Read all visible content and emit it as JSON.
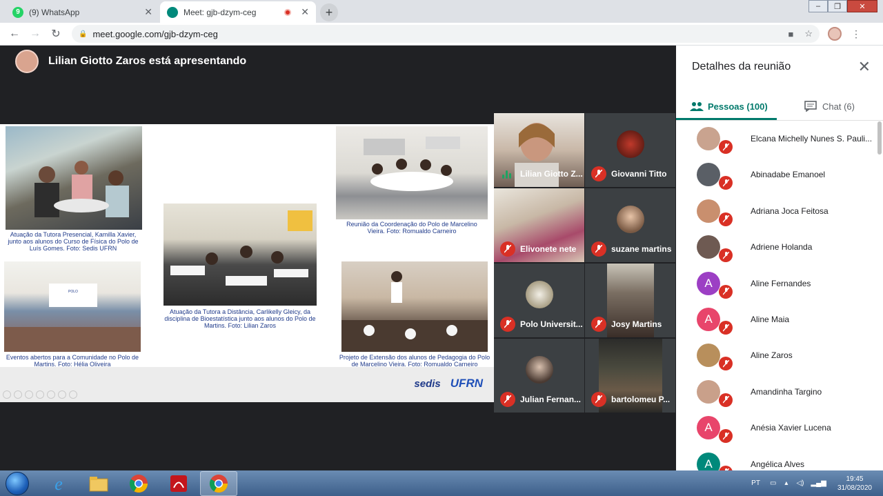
{
  "browser": {
    "tabs": [
      {
        "title": "(9) WhatsApp",
        "badge": "9",
        "active": false
      },
      {
        "title": "Meet: gjb-dzym-ceg",
        "active": true
      }
    ],
    "url": "meet.google.com/gjb-dzym-ceg"
  },
  "stage": {
    "presenter_text": "Lilian Giotto Zaros está apresentando"
  },
  "slide": {
    "captions": [
      "Atuação da Tutora Presencial, Kamilla Xavier, junto aos alunos do Curso de Física do Polo de Luís Gomes. Foto: Sedis UFRN",
      "Atuação da Tutora a Distância, Carlikelly Gleicy, da disciplina de Bioestatística junto aos alunos do Polo de Martins. Foto: Lilian Zaros",
      "Reunião da Coordenação do Polo de Marcelino Vieira. Foto: Romualdo Carneiro",
      "Eventos abertos para a Comunidade no Polo de Martins. Foto: Hélia Oliveira",
      "Projeto de Extensão dos alunos de Pedagogia do Polo de Marcelino Vieira. Foto: Romualdo Carneiro"
    ],
    "logo_sedis": "sedis",
    "logo_ufrn": "UFRN"
  },
  "tiles": [
    {
      "name": "Lilian Giotto Z...",
      "muted": false
    },
    {
      "name": "Giovanni Titto",
      "muted": true
    },
    {
      "name": "Elivonete nete",
      "muted": true
    },
    {
      "name": "suzane martins",
      "muted": true
    },
    {
      "name": "Polo Universit...",
      "muted": true
    },
    {
      "name": "Josy Martins",
      "muted": true
    },
    {
      "name": "Julian Fernan...",
      "muted": true
    },
    {
      "name": "bartolomeu P...",
      "muted": true
    }
  ],
  "panel": {
    "title": "Detalhes da reunião",
    "people_tab": "Pessoas (100)",
    "chat_tab": "Chat (6)",
    "people": [
      {
        "name": "Elcana Michelly Nunes S. Pauli...",
        "initial": "",
        "color": "#c9a38f"
      },
      {
        "name": "Abinadabe Emanoel",
        "initial": "",
        "color": "#5a5f66"
      },
      {
        "name": "Adriana Joca Feitosa",
        "initial": "",
        "color": "#c98f6e"
      },
      {
        "name": "Adriene Holanda",
        "initial": "",
        "color": "#6e5a52"
      },
      {
        "name": "Aline Fernandes",
        "initial": "A",
        "color": "#9c3fc4"
      },
      {
        "name": "Aline Maia",
        "initial": "A",
        "color": "#e8456b"
      },
      {
        "name": "Aline Zaros",
        "initial": "",
        "color": "#b88f5c"
      },
      {
        "name": "Amandinha Targino",
        "initial": "",
        "color": "#c9a08a"
      },
      {
        "name": "Anésia Xavier Lucena",
        "initial": "A",
        "color": "#e8456b"
      },
      {
        "name": "Angélica Alves",
        "initial": "A",
        "color": "#00897b"
      }
    ]
  },
  "taskbar": {
    "lang": "PT",
    "time": "19:45",
    "date": "31/08/2020"
  }
}
